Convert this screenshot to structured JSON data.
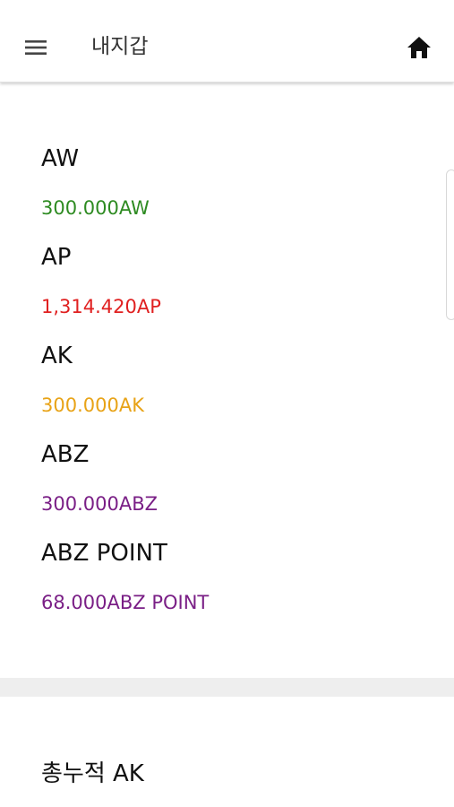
{
  "header": {
    "menu_icon": "hamburger-menu-icon",
    "title": "내지갑",
    "home_icon": "home-icon"
  },
  "assets": [
    {
      "name": "AW",
      "value": "300.000AW",
      "color": "#2e8b22"
    },
    {
      "name": "AP",
      "value": "1,314.420AP",
      "color": "#e02020"
    },
    {
      "name": "AK",
      "value": "300.000AK",
      "color": "#e8a317"
    },
    {
      "name": "ABZ",
      "value": "300.000ABZ",
      "color": "#7a1f86"
    },
    {
      "name": "ABZ POINT",
      "value": "68.000ABZ POINT",
      "color": "#7a1f86"
    }
  ],
  "summary": {
    "label": "총누적 AK"
  }
}
